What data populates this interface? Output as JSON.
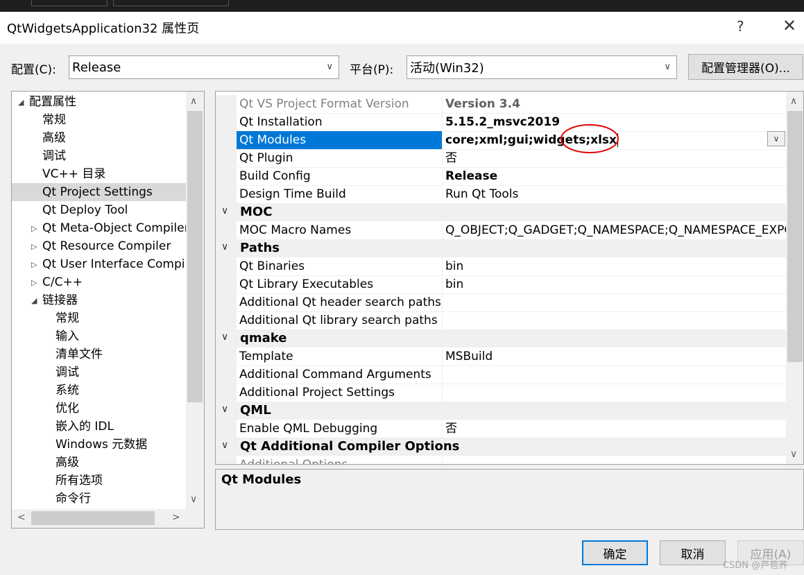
{
  "window": {
    "title": "QtWidgetsApplication32 属性页",
    "help_label": "?",
    "close_label": "✕"
  },
  "config": {
    "config_label": "配置(C):",
    "config_value": "Release",
    "platform_label": "平台(P):",
    "platform_value": "活动(Win32)",
    "manager_button": "配置管理器(O)..."
  },
  "tree": {
    "items": [
      {
        "label": "配置属性",
        "expander": "◢"
      },
      {
        "label": "常规"
      },
      {
        "label": "高级"
      },
      {
        "label": "调试"
      },
      {
        "label": "VC++ 目录"
      },
      {
        "label": "Qt Project Settings"
      },
      {
        "label": "Qt Deploy Tool"
      },
      {
        "label": "Qt Meta-Object Compiler",
        "expander": "▷"
      },
      {
        "label": "Qt Resource Compiler",
        "expander": "▷"
      },
      {
        "label": "Qt User Interface Compiler",
        "expander": "▷"
      },
      {
        "label": "C/C++",
        "expander": "▷"
      },
      {
        "label": "链接器",
        "expander": "◢"
      },
      {
        "label": "常规"
      },
      {
        "label": "输入"
      },
      {
        "label": "清单文件"
      },
      {
        "label": "调试"
      },
      {
        "label": "系统"
      },
      {
        "label": "优化"
      },
      {
        "label": "嵌入的 IDL"
      },
      {
        "label": "Windows 元数据"
      },
      {
        "label": "高级"
      },
      {
        "label": "所有选项"
      },
      {
        "label": "命令行"
      }
    ],
    "selected_index": 5
  },
  "grid": {
    "rows": [
      {
        "type": "prop",
        "name": "Qt VS Project Format Version",
        "value": "Version 3.4",
        "dim": true,
        "bold": true
      },
      {
        "type": "prop",
        "name": "Qt Installation",
        "value": "5.15.2_msvc2019",
        "bold": true
      },
      {
        "type": "prop",
        "name": "Qt Modules",
        "value": "core;xml;gui;widgets;xlsx",
        "bold": true,
        "selected": true
      },
      {
        "type": "prop",
        "name": "Qt Plugin",
        "value": "否"
      },
      {
        "type": "prop",
        "name": "Build Config",
        "value": "Release",
        "bold": true
      },
      {
        "type": "prop",
        "name": "Design Time Build",
        "value": "Run Qt Tools"
      },
      {
        "type": "cat",
        "name": "MOC"
      },
      {
        "type": "prop",
        "name": "MOC Macro Names",
        "value": "Q_OBJECT;Q_GADGET;Q_NAMESPACE;Q_NAMESPACE_EXPORT"
      },
      {
        "type": "cat",
        "name": "Paths"
      },
      {
        "type": "prop",
        "name": "Qt Binaries",
        "value": "bin"
      },
      {
        "type": "prop",
        "name": "Qt Library Executables",
        "value": "bin"
      },
      {
        "type": "prop",
        "name": "Additional Qt header search paths",
        "value": ""
      },
      {
        "type": "prop",
        "name": "Additional Qt library search paths",
        "value": ""
      },
      {
        "type": "cat",
        "name": "qmake"
      },
      {
        "type": "prop",
        "name": "Template",
        "value": "MSBuild"
      },
      {
        "type": "prop",
        "name": "Additional Command Arguments",
        "value": ""
      },
      {
        "type": "prop",
        "name": "Additional Project Settings",
        "value": ""
      },
      {
        "type": "cat",
        "name": "QML"
      },
      {
        "type": "prop",
        "name": "Enable QML Debugging",
        "value": "否"
      },
      {
        "type": "cat",
        "name": "Qt Additional Compiler Options"
      },
      {
        "type": "prop",
        "name": "Additional Options",
        "value": "",
        "dim": true
      }
    ],
    "category_chevron": "∨",
    "dropdown_chevron": "∨"
  },
  "description": {
    "title": "Qt Modules"
  },
  "footer": {
    "ok": "确定",
    "cancel": "取消",
    "apply": "应用(A)",
    "watermark": "CSDN @芦苞荞"
  },
  "colors": {
    "selection": "#0078d7",
    "annotation_circle": "#e00000"
  }
}
